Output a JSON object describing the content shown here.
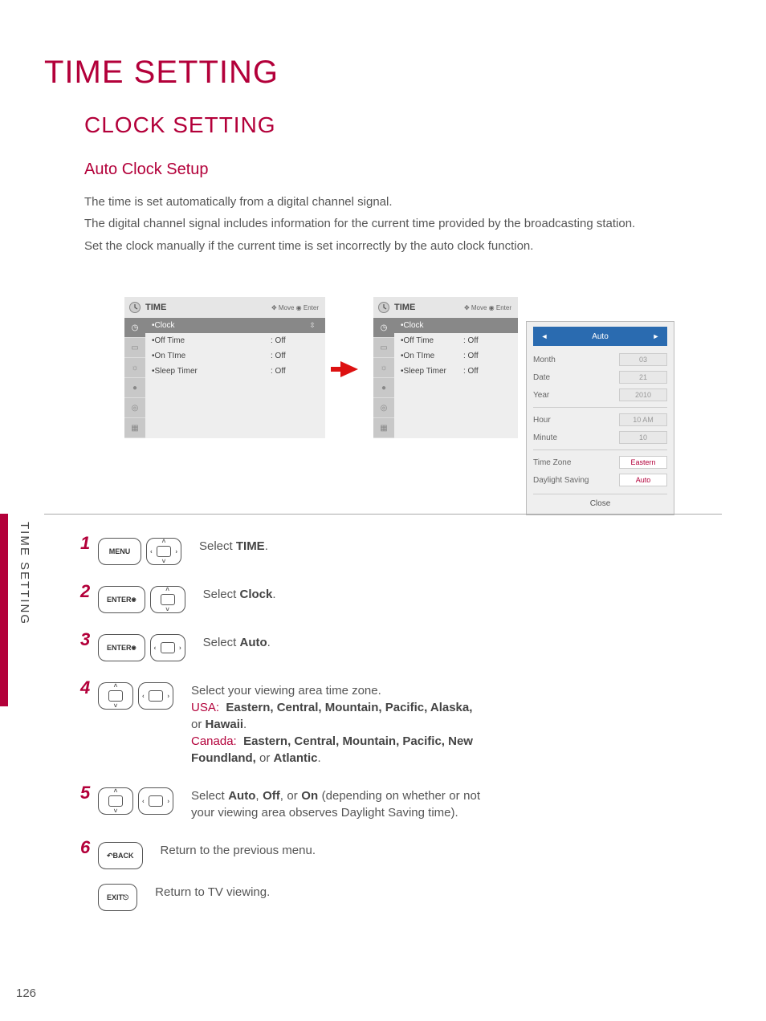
{
  "page": {
    "number": "126",
    "sidebar_label": "TIME SETTING",
    "title": "TIME SETTING",
    "section": "CLOCK SETTING",
    "subsection": "Auto Clock Setup",
    "paragraphs": [
      "The time is set automatically from a digital channel signal.",
      "The digital channel signal includes information for the current time provided by the broadcasting station.",
      "Set the clock manually if the current time is set incorrectly by the auto clock function."
    ]
  },
  "osd": {
    "title": "TIME",
    "hint_move": "Move",
    "hint_enter": "Enter",
    "items": [
      {
        "label": "Clock",
        "value": "",
        "selected": true
      },
      {
        "label": "Off Time",
        "value": ": Off"
      },
      {
        "label": "On TIme",
        "value": ": Off"
      },
      {
        "label": "Sleep Timer",
        "value": ": Off"
      }
    ]
  },
  "clock_panel": {
    "tabs": {
      "left": "◄",
      "mid": "Auto",
      "right": "►"
    },
    "rows": [
      {
        "k": "Month",
        "v": "03",
        "live": false
      },
      {
        "k": "Date",
        "v": "21",
        "live": false
      },
      {
        "k": "Year",
        "v": "2010",
        "live": false
      }
    ],
    "rows2": [
      {
        "k": "Hour",
        "v": "10 AM",
        "live": false
      },
      {
        "k": "Minute",
        "v": "10",
        "live": false
      }
    ],
    "rows3": [
      {
        "k": "Time Zone",
        "v": "Eastern",
        "live": true
      },
      {
        "k": "Daylight Saving",
        "v": "Auto",
        "live": true
      }
    ],
    "close": "Close"
  },
  "steps": {
    "s1": {
      "num": "1",
      "btn1": "MENU",
      "text_pre": "Select ",
      "text_b": "TIME",
      "text_post": "."
    },
    "s2": {
      "num": "2",
      "btn1": "ENTER",
      "text_pre": "Select ",
      "text_b": "Clock",
      "text_post": "."
    },
    "s3": {
      "num": "3",
      "btn1": "ENTER",
      "text_pre": "Select ",
      "text_b": "Auto",
      "text_post": "."
    },
    "s4": {
      "num": "4",
      "line1": "Select your viewing area time zone.",
      "usa_label": "USA:",
      "usa_opts": "Eastern, Central, Mountain, Pacific, Alaska, ",
      "usa_or": "or ",
      "usa_last": "Hawaii",
      "usa_dot": ".",
      "can_label": "Canada:",
      "can_opts": "Eastern, Central, Mountain, Pacific, New Foundland, ",
      "can_or": "or ",
      "can_last": "Atlantic",
      "can_dot": "."
    },
    "s5": {
      "num": "5",
      "pre": "Select ",
      "b1": "Auto",
      "sep1": ", ",
      "b2": "Off",
      "sep2": ", or ",
      "b3": "On",
      "post": " (depending on whether or not your viewing area observes Daylight Saving time)."
    },
    "s6": {
      "num": "6",
      "btn": "BACK",
      "text": "Return to the previous menu."
    },
    "s7": {
      "btn": "EXIT",
      "text": "Return to TV viewing."
    }
  }
}
